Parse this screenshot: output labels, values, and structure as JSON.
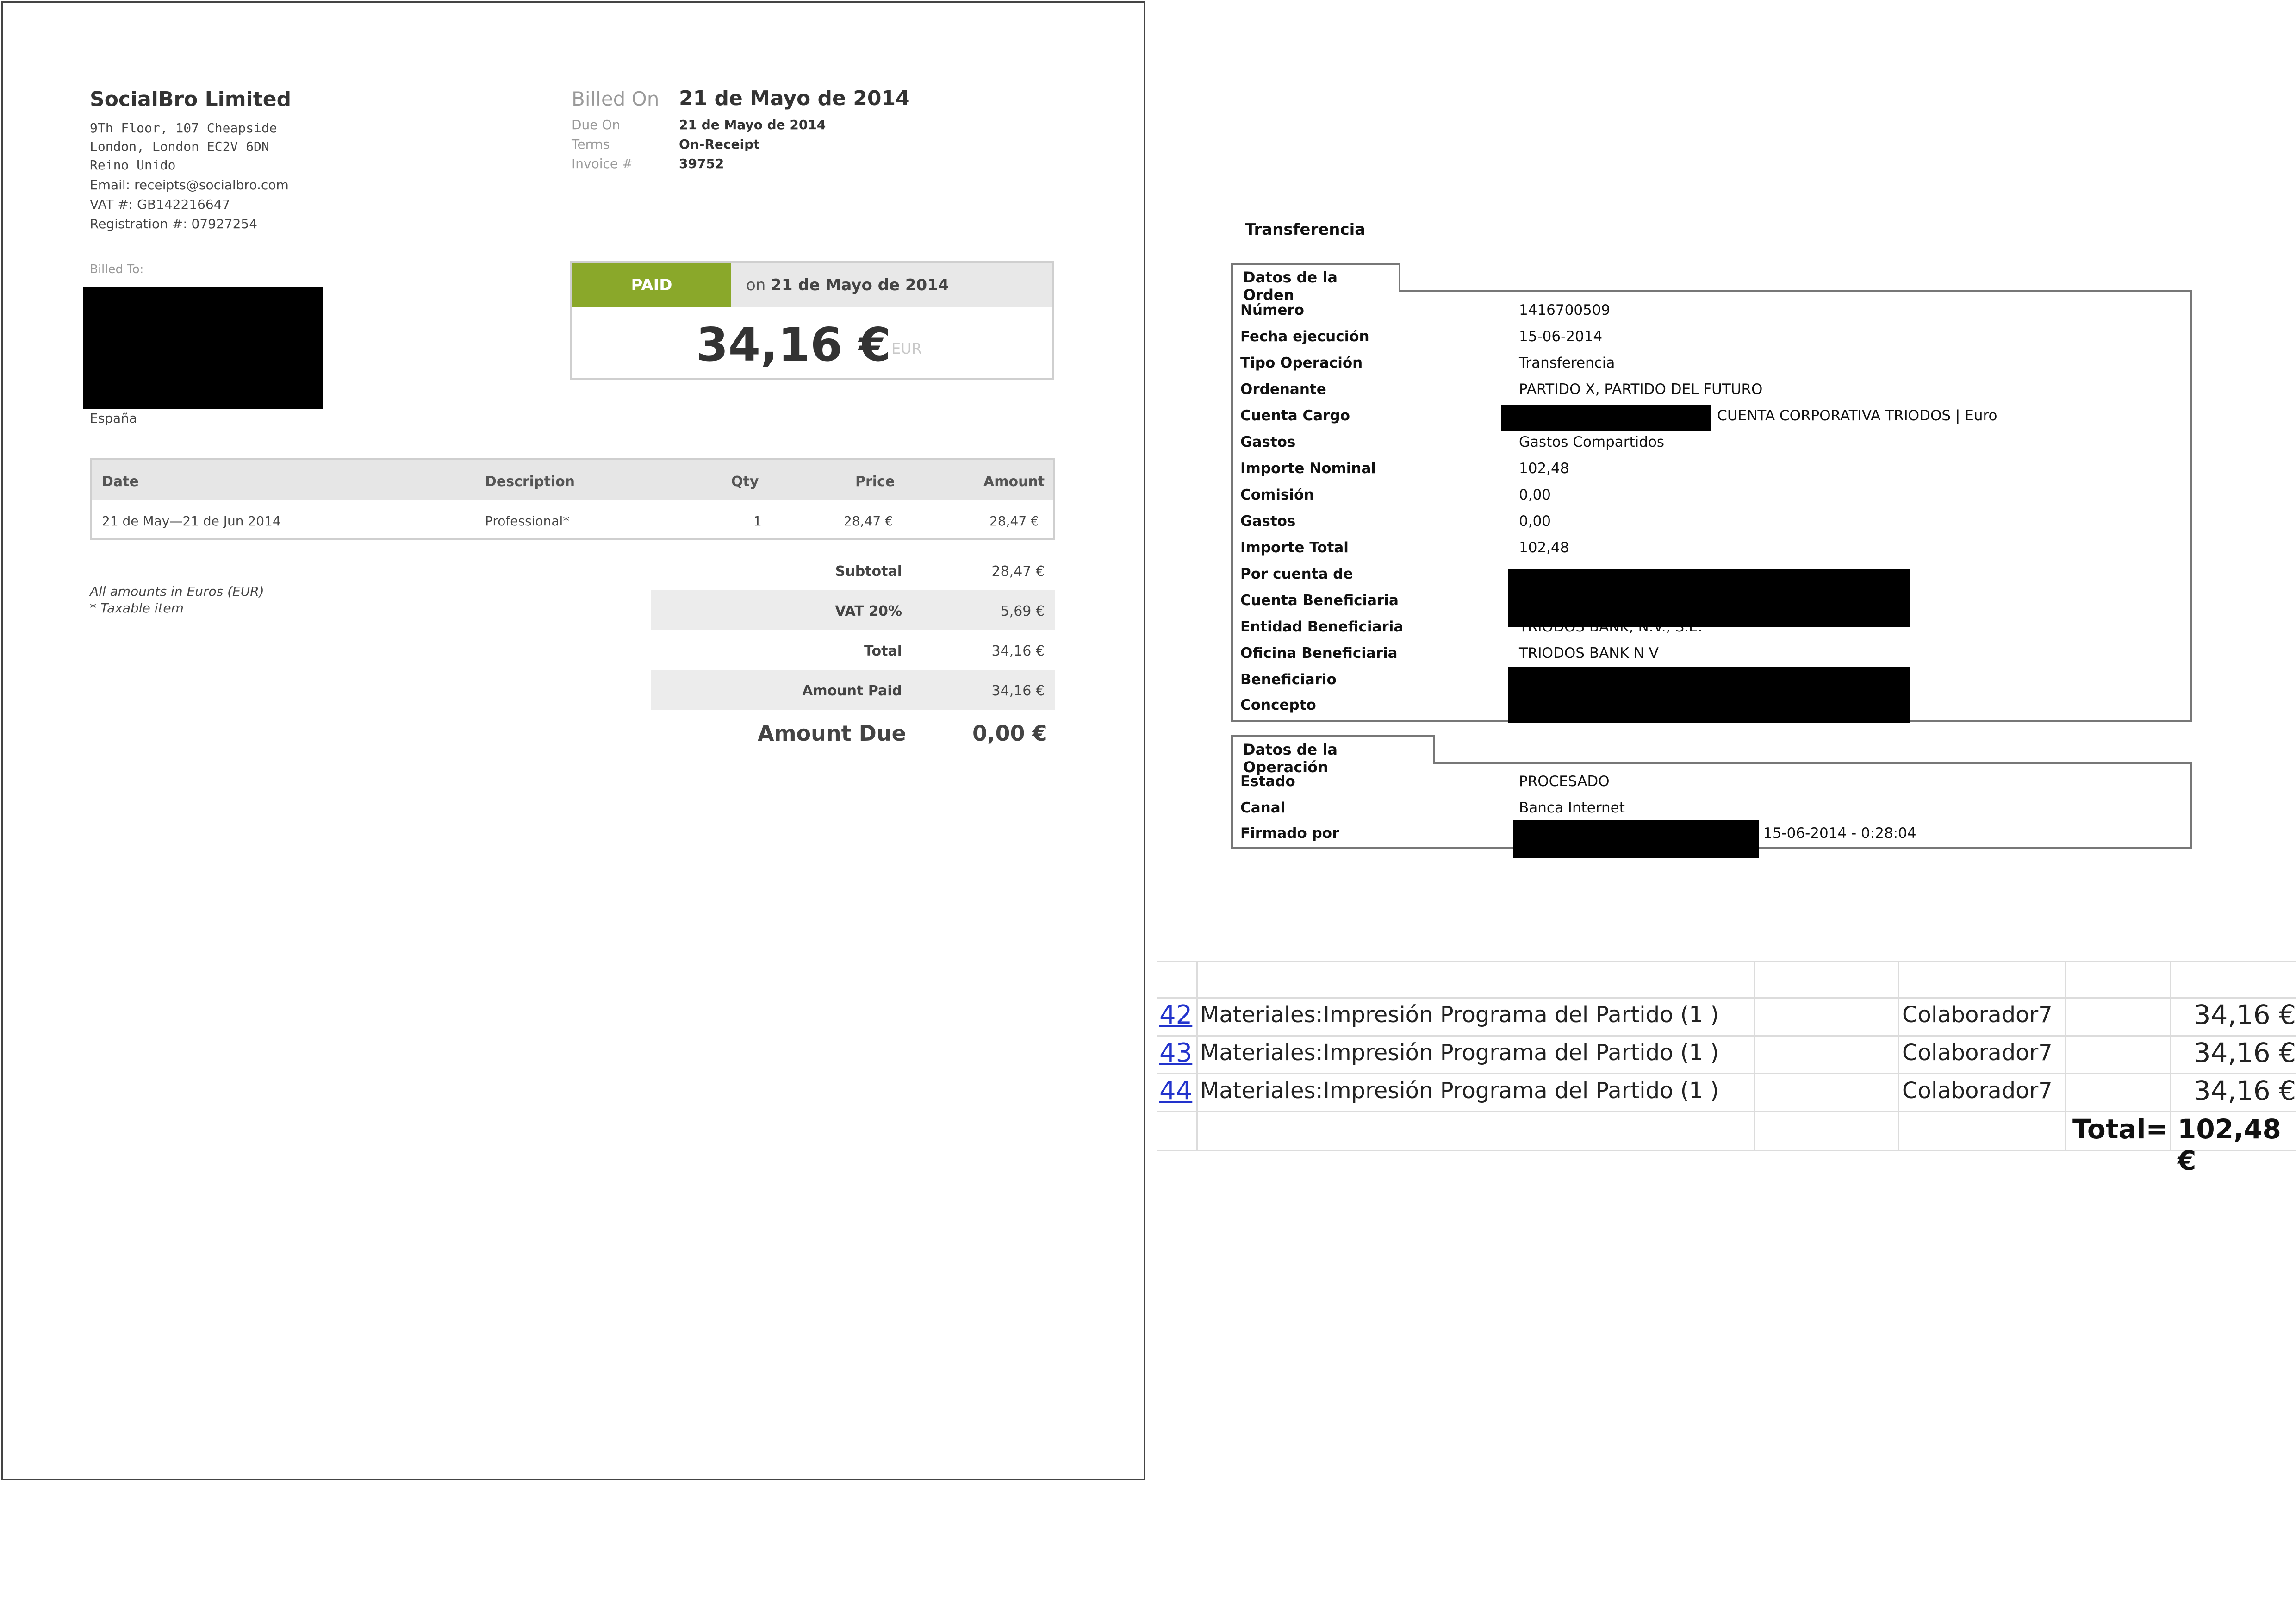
{
  "invoice": {
    "company": "SocialBro Limited",
    "address_lines": [
      "9Th Floor, 107 Cheapside",
      "London, London EC2V 6DN",
      "Reino Unido"
    ],
    "email": "Email: receipts@socialbro.com",
    "vat": "VAT #: GB142216647",
    "registration": "Registration #: 07927254",
    "billed_on_label": "Billed On",
    "billed_on_value": "21 de Mayo de 2014",
    "due_on_label": "Due On",
    "due_on_value": "21 de Mayo de 2014",
    "terms_label": "Terms",
    "terms_value": "On-Receipt",
    "invoice_label": "Invoice #",
    "invoice_value": "39752",
    "billed_to_label": "Billed To:",
    "country": "España",
    "paid_tag": "PAID",
    "paid_on_prefix": "on",
    "paid_on_date": "21 de Mayo de 2014",
    "big_amount": "34,16 €",
    "currency": "EUR",
    "table": {
      "headers": {
        "date": "Date",
        "description": "Description",
        "qty": "Qty",
        "price": "Price",
        "amount": "Amount"
      },
      "row": {
        "date": "21 de May—21 de Jun 2014",
        "description": "Professional*",
        "qty": "1",
        "price": "28,47 €",
        "amount": "28,47 €"
      }
    },
    "summary": [
      {
        "label": "Subtotal",
        "value": "28,47 €"
      },
      {
        "label": "VAT 20%",
        "value": "5,69 €"
      },
      {
        "label": "Total",
        "value": "34,16 €"
      },
      {
        "label": "Amount Paid",
        "value": "34,16 €"
      }
    ],
    "amount_due_label": "Amount Due",
    "amount_due_value": "0,00 €",
    "note1": "All amounts in Euros (EUR)",
    "note2": "* Taxable item"
  },
  "bank": {
    "title": "Transferencia",
    "order_section": "Datos de la Orden",
    "order_fields": [
      {
        "label": "Número",
        "value": "1416700509"
      },
      {
        "label": "Fecha ejecución",
        "value": "15-06-2014"
      },
      {
        "label": "Tipo Operación",
        "value": "Transferencia"
      },
      {
        "label": "Ordenante",
        "value": "PARTIDO X, PARTIDO DEL FUTURO"
      },
      {
        "label": "Cuenta Cargo",
        "value": "| CUENTA CORPORATIVA TRIODOS | Euro"
      },
      {
        "label": "Gastos",
        "value": "Gastos Compartidos"
      },
      {
        "label": "Importe Nominal",
        "value": "102,48"
      },
      {
        "label": "Comisión",
        "value": "0,00"
      },
      {
        "label": "Gastos",
        "value": "0,00"
      },
      {
        "label": "Importe Total",
        "value": "102,48"
      },
      {
        "label": "Por cuenta de",
        "value": ""
      },
      {
        "label": "Cuenta Beneficiaria",
        "value": ""
      },
      {
        "label": "Entidad Beneficiaria",
        "value": "TRIODOS BANK, N.V., S.E."
      },
      {
        "label": "Oficina Beneficiaria",
        "value": "TRIODOS BANK N V"
      },
      {
        "label": "Beneficiario",
        "value": ""
      },
      {
        "label": "Concepto",
        "value": ""
      }
    ],
    "operation_section": "Datos de la Operación",
    "operation_fields": [
      {
        "label": "Estado",
        "value": "PROCESADO"
      },
      {
        "label": "Canal",
        "value": "Banca Internet"
      },
      {
        "label": "Firmado por",
        "value": "15-06-2014 - 0:28:04"
      }
    ]
  },
  "sheet": {
    "rows": [
      {
        "num": "42",
        "description": "Materiales:Impresión Programa del Partido (1 )",
        "collaborator": "Colaborador7",
        "amount": "34,16 €"
      },
      {
        "num": "43",
        "description": "Materiales:Impresión Programa del Partido (1 )",
        "collaborator": "Colaborador7",
        "amount": "34,16 €"
      },
      {
        "num": "44",
        "description": "Materiales:Impresión Programa del Partido (1 )",
        "collaborator": "Colaborador7",
        "amount": "34,16 €"
      }
    ],
    "total_label": "Total=",
    "total_value": "102,48 €"
  }
}
